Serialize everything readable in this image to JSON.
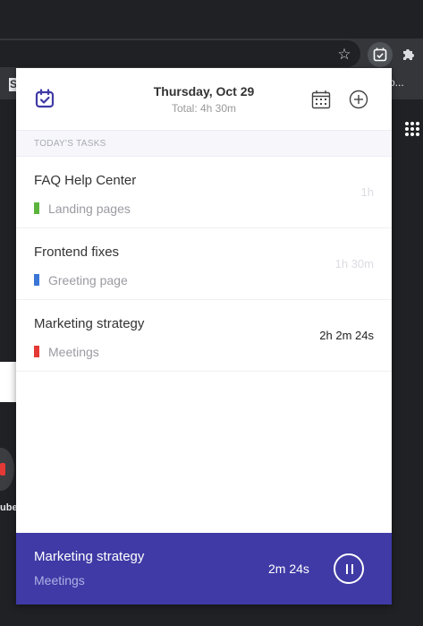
{
  "browser": {
    "bookmark_letter": "S",
    "bookmark_suffix": "o...",
    "side_label": "ube",
    "icons": {
      "star": "star-icon",
      "extension": "calendar-check-icon",
      "puzzle": "puzzle-icon",
      "apps": "apps-grid-icon"
    }
  },
  "popup": {
    "header": {
      "date": "Thursday, Oct 29",
      "total": "Total: 4h 30m",
      "icons": {
        "logo": "calendar-check-icon",
        "calendar": "calendar-icon",
        "add": "plus-circle-icon"
      }
    },
    "section_label": "TODAY'S TASKS",
    "tasks": [
      {
        "title": "FAQ Help Center",
        "project": "Landing pages",
        "project_color": "#5cb33c",
        "time": "1h",
        "active": false
      },
      {
        "title": "Frontend fixes",
        "project": "Greeting page",
        "project_color": "#3a76d6",
        "time": "1h 30m",
        "active": false
      },
      {
        "title": "Marketing strategy",
        "project": "Meetings",
        "project_color": "#e53935",
        "time": "2h 2m 24s",
        "active": true
      }
    ],
    "running": {
      "title": "Marketing strategy",
      "project": "Meetings",
      "elapsed": "2m 24s",
      "icon": "pause-icon"
    }
  },
  "colors": {
    "accent": "#3f3aa5",
    "chrome_dark": "#202124",
    "chrome": "#35363a"
  }
}
